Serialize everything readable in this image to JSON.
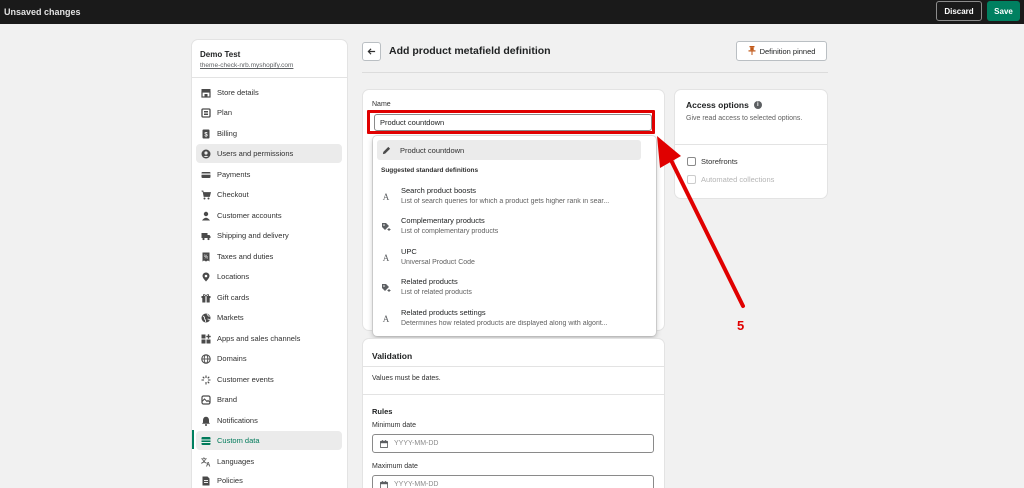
{
  "topbar": {
    "title": "Unsaved changes",
    "discard_label": "Discard",
    "save_label": "Save"
  },
  "sidebar": {
    "store_name": "Demo Test",
    "store_url": "theme-check-nrb.myshopify.com",
    "items": [
      {
        "label": "Store details",
        "icon": "store-icon"
      },
      {
        "label": "Plan",
        "icon": "plan-icon"
      },
      {
        "label": "Billing",
        "icon": "billing-icon"
      },
      {
        "label": "Users and permissions",
        "icon": "user-circle-icon"
      },
      {
        "label": "Payments",
        "icon": "payments-icon"
      },
      {
        "label": "Checkout",
        "icon": "cart-icon"
      },
      {
        "label": "Customer accounts",
        "icon": "person-icon"
      },
      {
        "label": "Shipping and delivery",
        "icon": "truck-icon"
      },
      {
        "label": "Taxes and duties",
        "icon": "tax-icon"
      },
      {
        "label": "Locations",
        "icon": "location-icon"
      },
      {
        "label": "Gift cards",
        "icon": "gift-icon"
      },
      {
        "label": "Markets",
        "icon": "globe-icon"
      },
      {
        "label": "Apps and sales channels",
        "icon": "apps-icon"
      },
      {
        "label": "Domains",
        "icon": "globe-icon"
      },
      {
        "label": "Customer events",
        "icon": "sparkle-icon"
      },
      {
        "label": "Brand",
        "icon": "brand-icon"
      },
      {
        "label": "Notifications",
        "icon": "bell-icon"
      },
      {
        "label": "Custom data",
        "icon": "database-icon"
      },
      {
        "label": "Languages",
        "icon": "translate-icon"
      },
      {
        "label": "Policies",
        "icon": "document-icon"
      }
    ]
  },
  "header": {
    "title": "Add product metafield definition",
    "pinned_label": "Definition pinned"
  },
  "name_field": {
    "label": "Name",
    "value": "Product countdown"
  },
  "dropdown": {
    "selected_label": "Product countdown",
    "heading": "Suggested standard definitions",
    "items": [
      {
        "title": "Search product boosts",
        "desc": "List of search queries for which a product gets higher rank in sear...",
        "icon": "text-icon"
      },
      {
        "title": "Complementary products",
        "desc": "List of complementary products",
        "icon": "product-reference-icon"
      },
      {
        "title": "UPC",
        "desc": "Universal Product Code",
        "icon": "text-icon"
      },
      {
        "title": "Related products",
        "desc": "List of related products",
        "icon": "product-reference-icon"
      },
      {
        "title": "Related products settings",
        "desc": "Determines how related products are displayed along with algorit...",
        "icon": "text-icon"
      }
    ]
  },
  "validation": {
    "title": "Validation",
    "text": "Values must be dates.",
    "rules_label": "Rules",
    "min_label": "Minimum date",
    "min_placeholder": "YYYY-MM-DD",
    "max_label": "Maximum date",
    "max_placeholder": "YYYY-MM-DD"
  },
  "access": {
    "title": "Access options",
    "desc": "Give read access to selected options.",
    "storefronts_label": "Storefronts",
    "automated_label": "Automated collections"
  },
  "annotation": {
    "step": "5",
    "color": "#e00000"
  }
}
